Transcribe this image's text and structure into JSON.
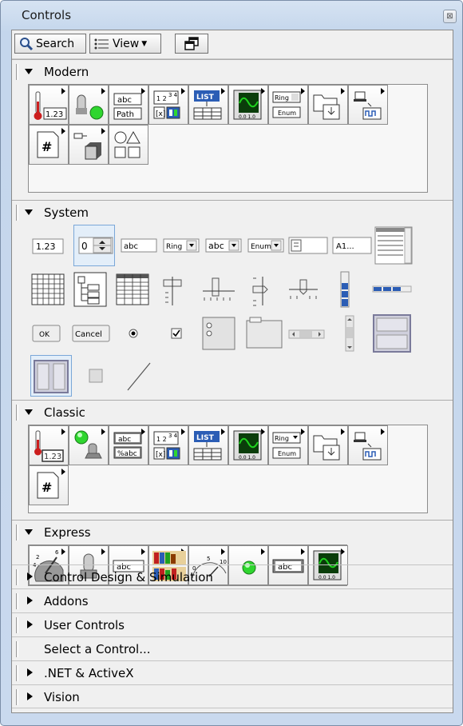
{
  "window": {
    "title": "Controls",
    "close_glyph": "⊠"
  },
  "toolbar": {
    "search_label": "Search",
    "view_label": "View"
  },
  "palettes": {
    "modern": {
      "label": "Modern",
      "icons": [
        "numeric-icon",
        "boolean-icon",
        "string-path-icon",
        "array-matrix-cluster-icon",
        "list-table-tree-icon",
        "graph-icon",
        "ring-enum-icon",
        "containers-icon",
        "io-icon",
        "variant-class-icon",
        "decorations-icon",
        "refnum-icon"
      ]
    },
    "system": {
      "label": "System",
      "numeric_text": "1.23",
      "spin_value": "0",
      "string_text": "abc",
      "ring_text": "Ring",
      "combo_text": "abc",
      "enum_text": "Enum",
      "path_text": "A1...",
      "ok_label": "OK",
      "cancel_label": "Cancel"
    },
    "classic": {
      "label": "Classic",
      "icons": [
        "classic-numeric-icon",
        "classic-boolean-icon",
        "classic-string-path-icon",
        "classic-array-matrix-cluster-icon",
        "classic-list-table-tree-icon",
        "classic-graph-icon",
        "classic-ring-enum-icon",
        "classic-containers-icon",
        "classic-io-icon",
        "classic-refnum-icon"
      ]
    },
    "express": {
      "label": "Express",
      "icons": [
        "express-numeric-controls-icon",
        "express-buttons-switches-icon",
        "express-text-controls-icon",
        "express-user-controls-icon",
        "express-numeric-indicators-icon",
        "express-leds-icon",
        "express-text-indicators-icon",
        "express-graph-indicators-icon"
      ]
    }
  },
  "categories": [
    {
      "label": "Control Design & Simulation",
      "expandable": true
    },
    {
      "label": "Addons",
      "expandable": true
    },
    {
      "label": "User Controls",
      "expandable": true
    },
    {
      "label": "Select a Control...",
      "expandable": false
    },
    {
      "label": ".NET & ActiveX",
      "expandable": true
    },
    {
      "label": "Vision",
      "expandable": true
    }
  ],
  "colors": {
    "accent_blue": "#2b5db5",
    "led_green": "#2fd62f",
    "graph_green": "#1fd31f",
    "thermo_red": "#cc1e1e"
  }
}
